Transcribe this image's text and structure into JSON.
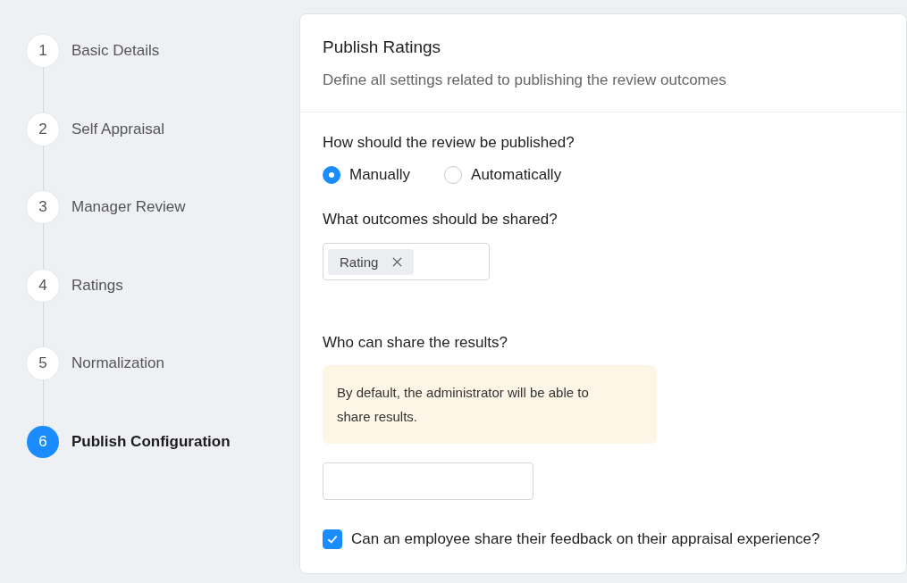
{
  "steps": [
    {
      "number": "1",
      "label": "Basic Details",
      "selected": false
    },
    {
      "number": "2",
      "label": "Self Appraisal",
      "selected": false
    },
    {
      "number": "3",
      "label": "Manager Review",
      "selected": false
    },
    {
      "number": "4",
      "label": "Ratings",
      "selected": false
    },
    {
      "number": "5",
      "label": "Normalization",
      "selected": false
    },
    {
      "number": "6",
      "label": "Publish Configuration",
      "selected": true
    }
  ],
  "card": {
    "title": "Publish Ratings",
    "subtitle": "Define all settings related to publishing the review outcomes",
    "publish_question": "How should the review be published?",
    "publish_options": [
      {
        "label": "Manually",
        "selected": true
      },
      {
        "label": "Automatically",
        "selected": false
      }
    ],
    "outcomes_question": "What outcomes should be shared?",
    "outcomes": [
      {
        "label": "Rating"
      }
    ],
    "share_question": "Who can share the results?",
    "info_note": "By default, the administrator will be able to share results.",
    "feedback_option": {
      "label": "Can an employee share their feedback on their appraisal experience?",
      "checked": true
    }
  }
}
